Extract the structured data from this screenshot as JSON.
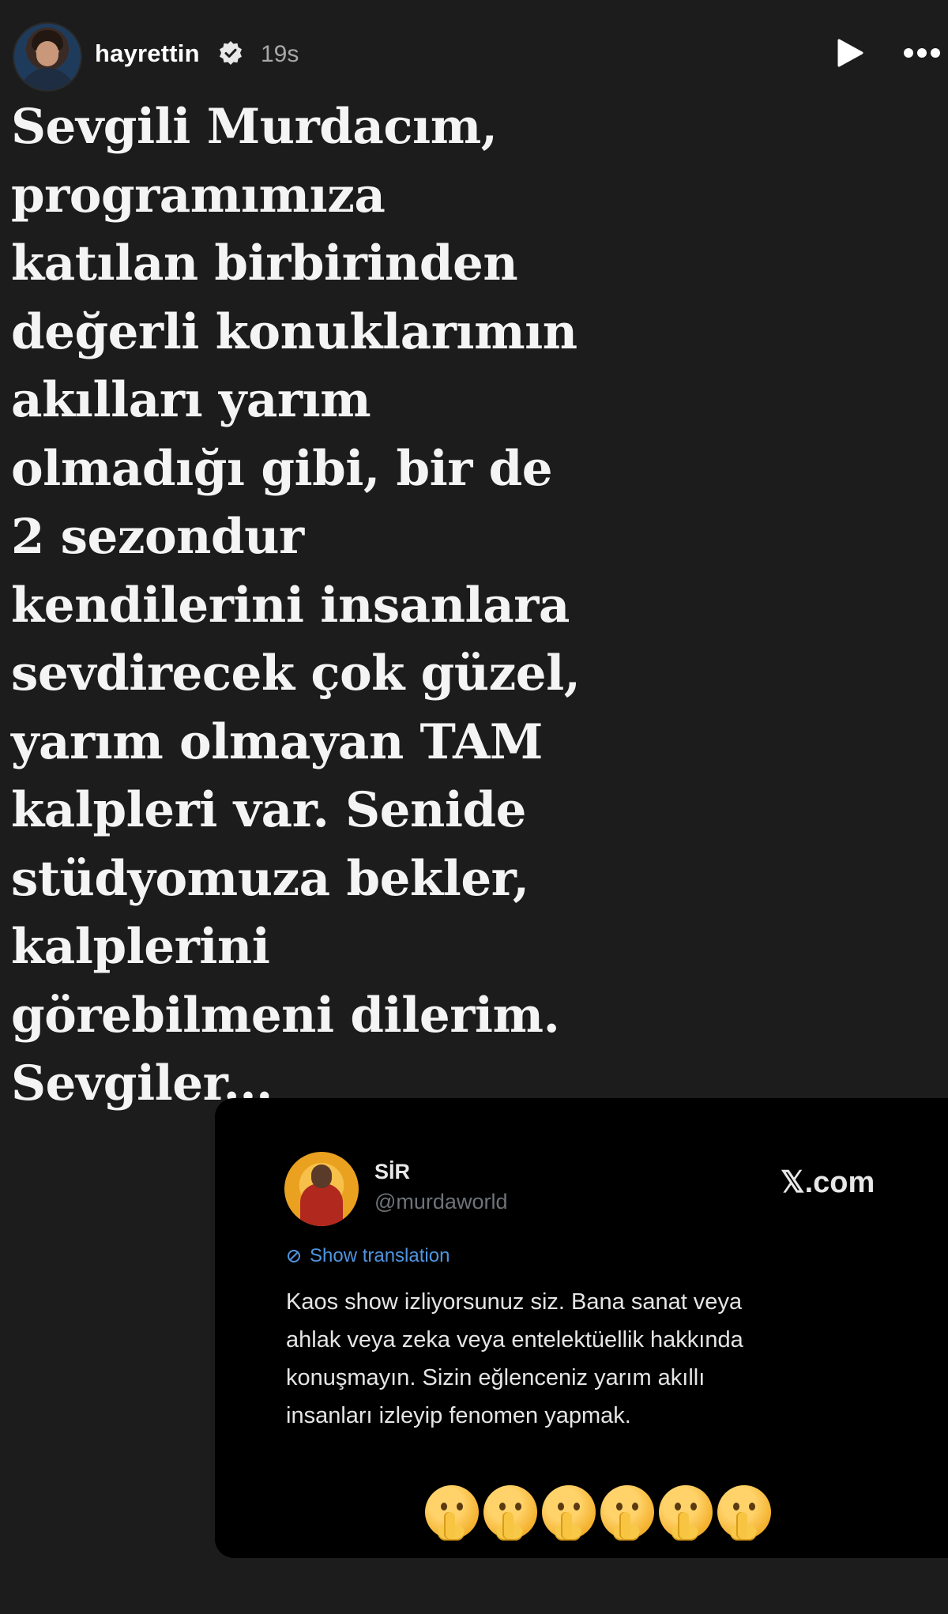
{
  "header": {
    "username": "hayrettin",
    "time": "19s",
    "avatar_icon": "profile-photo",
    "verified_icon": "verified-badge-icon",
    "play_icon": "play-icon",
    "more_icon": "more-options-icon"
  },
  "message": {
    "text": "Sevgili Murdacım,\nprogramımıza\nkatılan birbirinden\ndeğerli konuklarımın\nakılları yarım\nolmadığı gibi, bir de\n2 sezondur\nkendilerini insanlara\nsevdirecek çok güzel,\nyarım olmayan TAM\nkalpleri var. Senide\nstüdyomuza bekler,\nkalplerini\ngörebilmeni dilerim.\nSevgiler..."
  },
  "tweet": {
    "name": "SİR",
    "handle": "@murdaworld",
    "source": "𝕏.com",
    "translate_label": "Show translation",
    "text": "Kaos show izliyorsunuz siz. Bana sanat veya\nahlak veya zeka veya entelektüellik hakkında\nkonuşmayın. Sizin eğlenceniz yarım akıllı\ninsanları izleyip fenomen yapmak.",
    "emoji_icon": "shushing-face-emoji",
    "emoji_count": 6
  },
  "colors": {
    "background": "#1c1c1d",
    "tweet_background": "#000000",
    "link_blue": "#4f95e0",
    "muted": "#6e7378"
  }
}
